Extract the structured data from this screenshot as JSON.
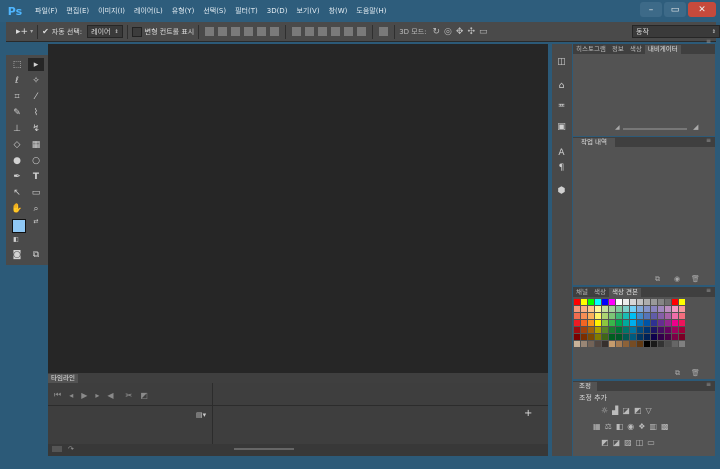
{
  "menubar": {
    "logo": "Ps",
    "items": [
      "파일(F)",
      "편집(E)",
      "이미지(I)",
      "레이어(L)",
      "유형(Y)",
      "선택(S)",
      "필터(T)",
      "3D(D)",
      "보기(V)",
      "창(W)",
      "도움말(H)"
    ],
    "minimize": "–",
    "maximize": "▭",
    "close": "✕"
  },
  "options": {
    "auto_select_label": "자동 선택:",
    "auto_select_value": "레이어",
    "transform_label": "변형 컨트롤 표시",
    "mode_3d_label": "3D 모드:",
    "workspace_value": "동작"
  },
  "panels": {
    "top_tabs": [
      "히스토그램",
      "정보",
      "색상",
      "내비게이터"
    ],
    "history_tab": "작업 내역",
    "color_tabs": [
      "채널",
      "색상",
      "색상 견본"
    ],
    "adjust_tab": "조정",
    "adjust_add": "조정 추가"
  },
  "timeline": {
    "title": "타임라인",
    "add": "+"
  },
  "colors": {
    "foreground": "#8fc8f5",
    "background": "#ffffff",
    "swatches": [
      [
        "#ff0000",
        "#ffff00",
        "#00ff00",
        "#00ffff",
        "#0000ff",
        "#ff00ff",
        "#ffffff",
        "#ebebeb",
        "#d6d6d6",
        "#c2c2c2",
        "#adadad",
        "#999999",
        "#858585",
        "#707070",
        "#ff0000",
        "#ffff00"
      ],
      [
        "#f7977a",
        "#f9ad81",
        "#fdc68a",
        "#fff79a",
        "#c4df9b",
        "#a2d39c",
        "#82ca9d",
        "#7bcdc8",
        "#6ecff6",
        "#7ea7d8",
        "#8493ca",
        "#8882be",
        "#a187be",
        "#bc8dbf",
        "#f49ac2",
        "#f6989d"
      ],
      [
        "#f26c4f",
        "#f68e55",
        "#fbaf5c",
        "#fff467",
        "#acd372",
        "#7cc576",
        "#3bb878",
        "#1abbb4",
        "#00bff3",
        "#438ccb",
        "#5574b9",
        "#605ca8",
        "#855fa8",
        "#a763a8",
        "#f06ea9",
        "#f26d7d"
      ],
      [
        "#ed1c24",
        "#f26522",
        "#f7941d",
        "#fff200",
        "#8dc63f",
        "#39b54a",
        "#00a651",
        "#00a99d",
        "#00aeef",
        "#0072bc",
        "#0054a6",
        "#2e3192",
        "#662d91",
        "#92278f",
        "#ec008c",
        "#ed145b"
      ],
      [
        "#9e0b0f",
        "#a0410d",
        "#a36209",
        "#aba000",
        "#598527",
        "#197b30",
        "#007236",
        "#00746b",
        "#0076a3",
        "#004b80",
        "#003471",
        "#1b1464",
        "#440e62",
        "#630460",
        "#9e005d",
        "#9e0039"
      ],
      [
        "#790000",
        "#7b2e00",
        "#7d4900",
        "#827b00",
        "#406618",
        "#005e20",
        "#005826",
        "#005952",
        "#005b7f",
        "#003663",
        "#002157",
        "#0d004c",
        "#32004b",
        "#4b0049",
        "#7b0046",
        "#7a0026"
      ],
      [
        "#c7b299",
        "#998675",
        "#736357",
        "#534741",
        "#37302d",
        "#c69c6d",
        "#a67c52",
        "#8c6239",
        "#754c24",
        "#603913",
        "#000000",
        "#1a1a1a",
        "#333333",
        "#4d4d4d",
        "#666666",
        "#808080"
      ]
    ]
  }
}
